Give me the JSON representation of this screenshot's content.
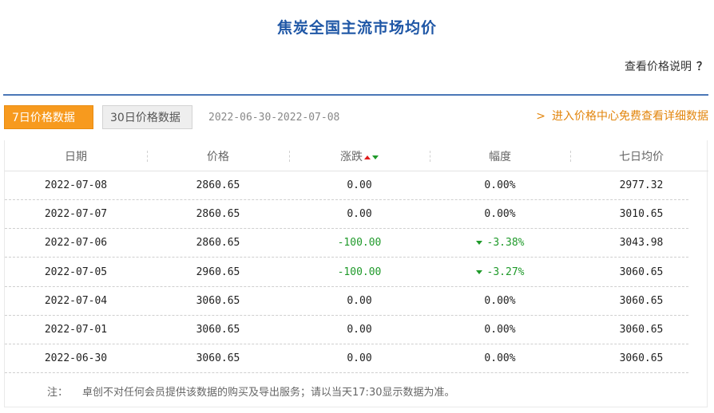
{
  "title": "焦炭全国主流市场均价",
  "explain": {
    "label": "查看价格说明",
    "icon": "？"
  },
  "tabs": [
    {
      "label": "7日价格数据",
      "active": true
    },
    {
      "label": "30日价格数据",
      "active": false
    }
  ],
  "date_range": "2022-06-30-2022-07-08",
  "promo": {
    "chevron": ">",
    "label": "进入价格中心免费查看详细数据"
  },
  "colors": {
    "title": "#1f57a6",
    "accent": "#f79a1e",
    "down": "#1f9a2a",
    "up": "#e01c1c",
    "rule": "#4b77b7"
  },
  "table": {
    "headers": [
      "日期",
      "价格",
      "涨跌",
      "幅度",
      "七日均价"
    ],
    "rows": [
      {
        "date": "2022-07-08",
        "price": "2860.65",
        "change": "0.00",
        "pct": "0.00%",
        "avg": "2977.32",
        "down": false
      },
      {
        "date": "2022-07-07",
        "price": "2860.65",
        "change": "0.00",
        "pct": "0.00%",
        "avg": "3010.65",
        "down": false
      },
      {
        "date": "2022-07-06",
        "price": "2860.65",
        "change": "-100.00",
        "pct": "-3.38%",
        "avg": "3043.98",
        "down": true
      },
      {
        "date": "2022-07-05",
        "price": "2960.65",
        "change": "-100.00",
        "pct": "-3.27%",
        "avg": "3060.65",
        "down": true
      },
      {
        "date": "2022-07-04",
        "price": "3060.65",
        "change": "0.00",
        "pct": "0.00%",
        "avg": "3060.65",
        "down": false
      },
      {
        "date": "2022-07-01",
        "price": "3060.65",
        "change": "0.00",
        "pct": "0.00%",
        "avg": "3060.65",
        "down": false
      },
      {
        "date": "2022-06-30",
        "price": "3060.65",
        "change": "0.00",
        "pct": "0.00%",
        "avg": "3060.65",
        "down": false
      }
    ]
  },
  "note": {
    "label": "注：",
    "text": "卓创不对任何会员提供该数据的购买及导出服务；请以当天17:30显示数据为准。"
  }
}
